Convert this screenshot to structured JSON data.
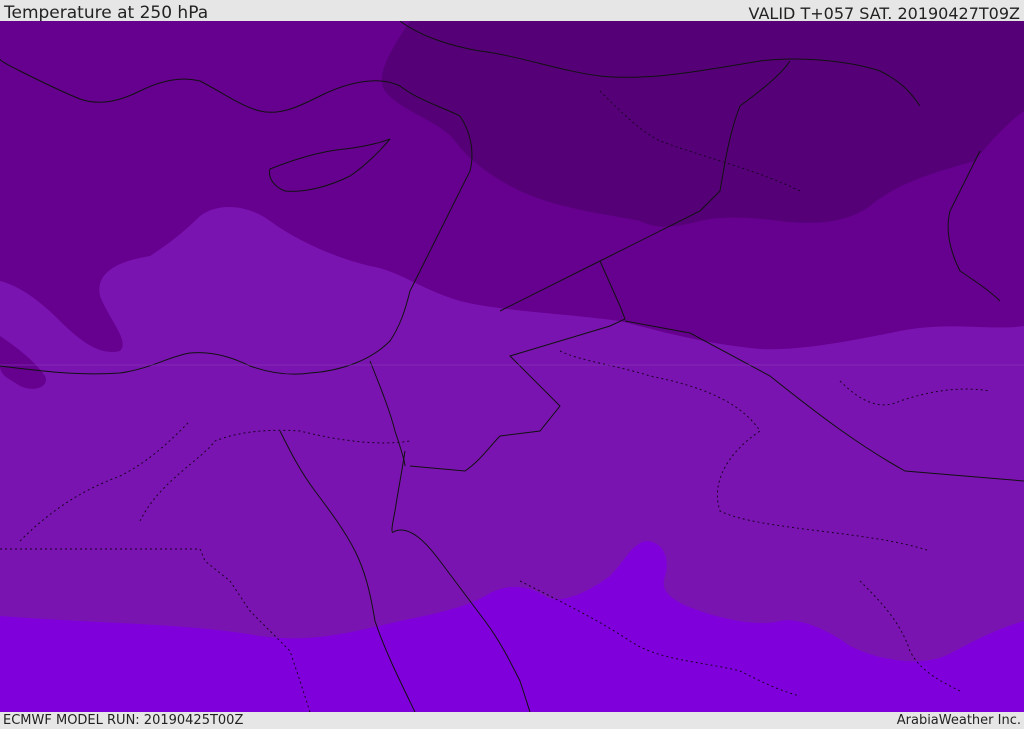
{
  "header": {
    "title": "Temperature at 250 hPa",
    "valid_time": "VALID T+057 SAT. 20190427T09Z"
  },
  "footer": {
    "model_run": "ECMWF MODEL RUN: 20190425T00Z",
    "credit": "ArabiaWeather Inc."
  },
  "colors": {
    "band_coldest": "#560078",
    "band_cold": "#66008f",
    "band_mid": "#7a14b0",
    "band_warm": "#8000dc",
    "coastline": "#111111",
    "topbar_bg": "#e6e6e6"
  }
}
